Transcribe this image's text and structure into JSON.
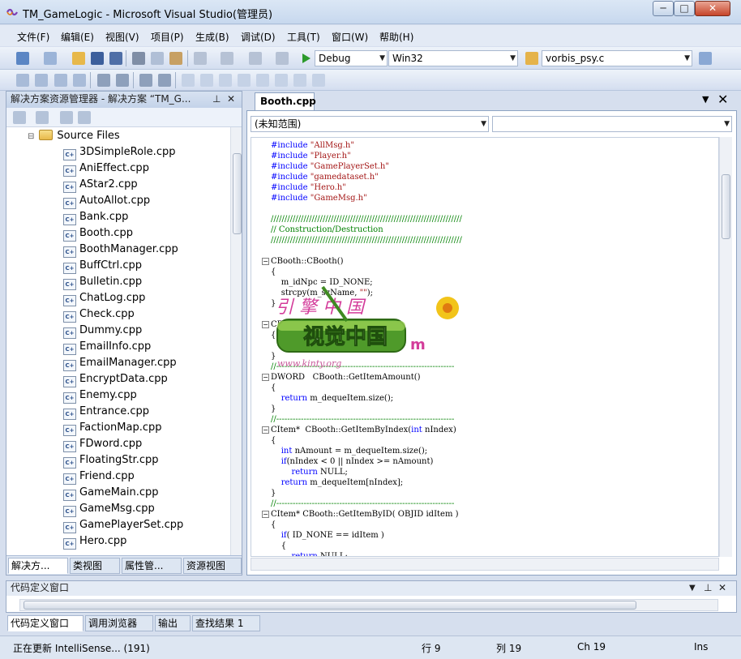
{
  "window": {
    "title": "TM_GameLogic - Microsoft Visual Studio(管理员)",
    "min_glyph": "─",
    "max_glyph": "□",
    "close_glyph": "✕"
  },
  "menu": [
    "文件(F)",
    "编辑(E)",
    "视图(V)",
    "项目(P)",
    "生成(B)",
    "调试(D)",
    "工具(T)",
    "窗口(W)",
    "帮助(H)"
  ],
  "toolbar": {
    "config": "Debug",
    "platform": "Win32",
    "find_file": "vorbis_psy.c"
  },
  "solution_explorer": {
    "header": "解决方案资源管理器 - 解决方案 “TM_G...",
    "folder": "Source Files",
    "files": [
      "3DSimpleRole.cpp",
      "AniEffect.cpp",
      "AStar2.cpp",
      "AutoAllot.cpp",
      "Bank.cpp",
      "Booth.cpp",
      "BoothManager.cpp",
      "BuffCtrl.cpp",
      "Bulletin.cpp",
      "ChatLog.cpp",
      "Check.cpp",
      "Dummy.cpp",
      "EmailInfo.cpp",
      "EmailManager.cpp",
      "EncryptData.cpp",
      "Enemy.cpp",
      "Entrance.cpp",
      "FactionMap.cpp",
      "FDword.cpp",
      "FloatingStr.cpp",
      "Friend.cpp",
      "GameMain.cpp",
      "GameMsg.cpp",
      "GamePlayerSet.cpp",
      "Hero.cpp"
    ],
    "tabs": [
      "解决方...",
      "类视图",
      "属性管...",
      "资源视图"
    ]
  },
  "editor": {
    "tab": "Booth.cpp",
    "scope": "(未知范围)",
    "scope2": "",
    "lines": [
      {
        "t": "#include \"AllMsg.h\"",
        "k": "inc"
      },
      {
        "t": "#include \"Player.h\"",
        "k": "inc"
      },
      {
        "t": "#include \"GamePlayerSet.h\"",
        "k": "inc"
      },
      {
        "t": "#include \"gamedataset.h\"",
        "k": "inc"
      },
      {
        "t": "#include \"Hero.h\"",
        "k": "inc"
      },
      {
        "t": "#include \"GameMsg.h\"",
        "k": "inc"
      },
      {
        "t": "",
        "k": "plain"
      },
      {
        "t": "//////////////////////////////////////////////////////////////////////",
        "k": "cm"
      },
      {
        "t": "// Construction/Destruction",
        "k": "cm"
      },
      {
        "t": "//////////////////////////////////////////////////////////////////////",
        "k": "cm"
      },
      {
        "t": "",
        "k": "plain"
      },
      {
        "t": "CBooth::CBooth()",
        "k": "plain"
      },
      {
        "t": "{",
        "k": "plain"
      },
      {
        "t": "    m_idNpc = ID_NONE;",
        "k": "plain"
      },
      {
        "t": "    strcpy(m_szName, \"\");",
        "k": "plain"
      },
      {
        "t": "}",
        "k": "plain"
      },
      {
        "t": "",
        "k": "plain"
      },
      {
        "t": "CBooth::~CBooth()",
        "k": "plain"
      },
      {
        "t": "{",
        "k": "plain"
      },
      {
        "t": "",
        "k": "plain"
      },
      {
        "t": "}",
        "k": "plain"
      },
      {
        "t": "//-----------------------------------------------------------------",
        "k": "cm"
      },
      {
        "t": "DWORD   CBooth::GetItemAmount()",
        "k": "plain"
      },
      {
        "t": "{",
        "k": "plain"
      },
      {
        "t": "    return m_dequeItem.size();",
        "k": "ret"
      },
      {
        "t": "}",
        "k": "plain"
      },
      {
        "t": "//-----------------------------------------------------------------",
        "k": "cm"
      },
      {
        "t": "CItem*  CBooth::GetItemByIndex(int nIndex)",
        "k": "int"
      },
      {
        "t": "{",
        "k": "plain"
      },
      {
        "t": "    int nAmount = m_dequeItem.size();",
        "k": "int"
      },
      {
        "t": "    if(nIndex < 0 || nIndex >= nAmount)",
        "k": "if"
      },
      {
        "t": "        return NULL;",
        "k": "ret"
      },
      {
        "t": "    return m_dequeItem[nIndex];",
        "k": "ret"
      },
      {
        "t": "}",
        "k": "plain"
      },
      {
        "t": "//-----------------------------------------------------------------",
        "k": "cm"
      },
      {
        "t": "CItem* CBooth::GetItemByID( OBJID idItem )",
        "k": "plain"
      },
      {
        "t": "{",
        "k": "plain"
      },
      {
        "t": "    if( ID_NONE == idItem )",
        "k": "if"
      },
      {
        "t": "    {",
        "k": "plain"
      },
      {
        "t": "        return NULL;",
        "k": "ret"
      }
    ]
  },
  "watermark": {
    "text": "视觉中国",
    "script": "引 擎 中 国",
    "url": "www.kinty.org",
    "suffix": "m"
  },
  "code_definition_window": {
    "header": "代码定义窗口",
    "tabs": [
      "代码定义窗口",
      "调用浏览器",
      "输出",
      "查找结果 1"
    ]
  },
  "status": {
    "message": "正在更新 IntelliSense... (191)",
    "line": "行 9",
    "col": "列 19",
    "ch": "Ch 19",
    "mode": "Ins"
  },
  "colors": {
    "keyword": "#0000ff",
    "string": "#a31515",
    "comment": "#008000"
  }
}
